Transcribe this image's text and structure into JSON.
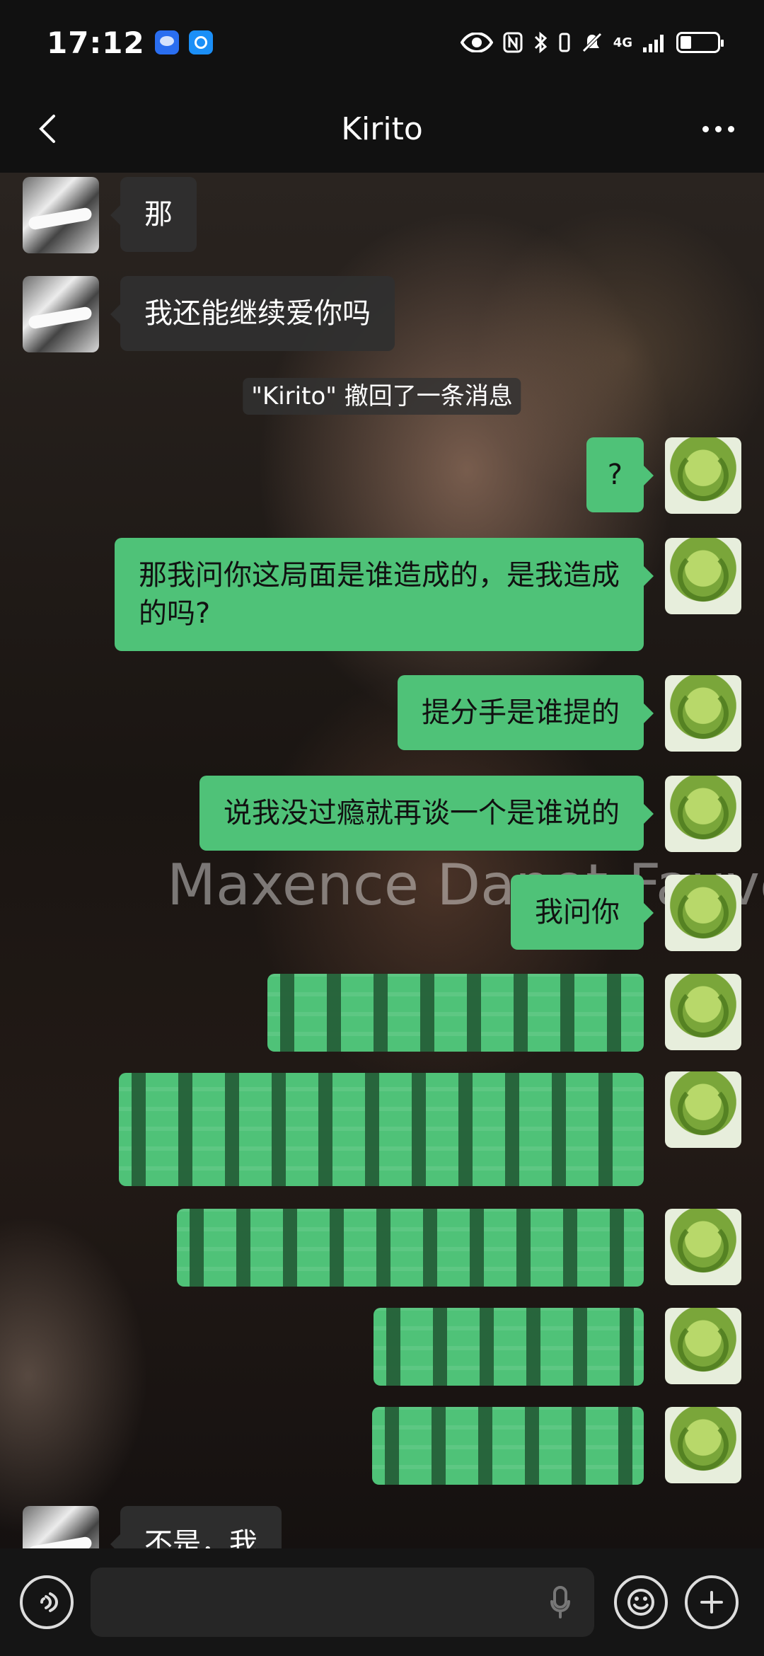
{
  "status_bar": {
    "time": "17:12",
    "network": "4G"
  },
  "header": {
    "title": "Kirito"
  },
  "messages": [
    {
      "side": "theirs",
      "text": "那"
    },
    {
      "side": "theirs",
      "text": "我还能继续爱你吗"
    },
    {
      "side": "mine",
      "text": "?"
    },
    {
      "side": "mine",
      "text": "那我问你这局面是谁造成的，是我造成的吗?"
    },
    {
      "side": "mine",
      "text": "提分手是谁提的"
    },
    {
      "side": "mine",
      "text": "说我没过瘾就再谈一个是谁说的"
    },
    {
      "side": "mine",
      "text": "我问你"
    },
    {
      "side": "theirs",
      "text": "不是，我"
    }
  ],
  "recall_notice": "\"Kirito\" 撤回了一条消息",
  "watermark": "Maxence Danet-Fauvel",
  "icons": {
    "back": "back-icon",
    "more": "more-icon",
    "voice": "voice-icon",
    "mic": "mic-icon",
    "emoji": "emoji-icon",
    "plus": "plus-icon"
  }
}
